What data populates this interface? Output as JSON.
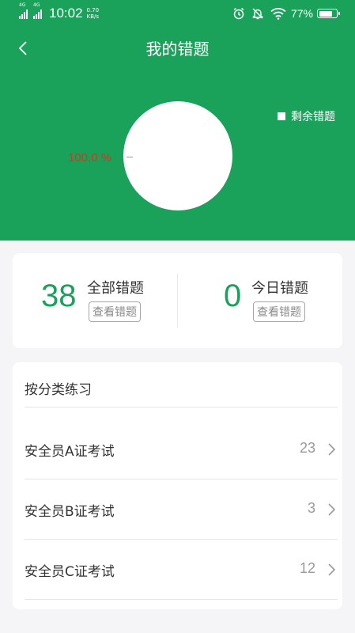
{
  "status_bar": {
    "network1": "4G",
    "network2": "4G",
    "time": "10:02",
    "speed_value": "0.70",
    "speed_unit": "KB/s",
    "battery": "77%",
    "battery_level": 0.77
  },
  "header": {
    "title": "我的错题",
    "back_icon": "chevron-left-icon"
  },
  "chart_data": {
    "type": "pie",
    "series": [
      {
        "name": "剩余错题",
        "values": [
          100.0
        ]
      }
    ],
    "slice_labels": [
      "100.0 %"
    ],
    "legend": {
      "entries": [
        "剩余错题"
      ],
      "position": "top-right"
    },
    "colors": {
      "slice": "#ffffff",
      "label": "#d23a1e"
    }
  },
  "stats": {
    "total": {
      "count": "38",
      "label": "全部错题",
      "button": "查看错题"
    },
    "today": {
      "count": "0",
      "label": "今日错题",
      "button": "查看错题"
    }
  },
  "categories": {
    "title": "按分类练习",
    "items": [
      {
        "name": "安全员A证考试",
        "count": "23"
      },
      {
        "name": "安全员B证考试",
        "count": "3"
      },
      {
        "name": "安全员C证考试",
        "count": "12"
      }
    ]
  },
  "colors": {
    "accent": "#1aa15a",
    "background": "#f5f5f7"
  }
}
